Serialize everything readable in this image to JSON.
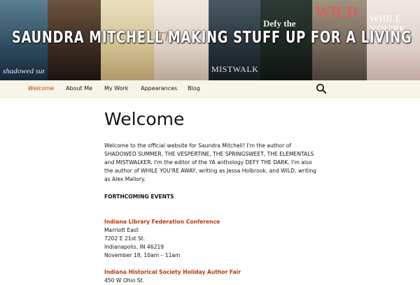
{
  "header": {
    "site_title": "SAUNDRA MITCHELL MAKING STUFF UP FOR A LIVING",
    "covers": [
      {
        "name": "shadowed-summer",
        "title": "shadowed summer",
        "bg": "linear-gradient(180deg,#5c7f92 0%,#304f62 55%,#16283a 100%)",
        "color": "#dbe9f2"
      },
      {
        "name": "the-vespertine",
        "title": "",
        "bg": "linear-gradient(180deg,#6e553f 0%,#3a2a20 60%,#1d1410 100%)",
        "color": "#e6d8c4"
      },
      {
        "name": "the-springsweet",
        "title": "",
        "bg": "linear-gradient(180deg,#ebe0c0 0%,#d2c394 55%,#b09868 100%)",
        "color": "#6b5230"
      },
      {
        "name": "the-elementals",
        "title": "The",
        "bg": "linear-gradient(180deg,#f1e9e2 0%,#dcd0c4 60%,#b9a896 100%)",
        "color": "#9c8a78"
      },
      {
        "name": "windswept",
        "title": "",
        "bg": "linear-gradient(180deg,#a8bccd 0%,#7f95a6 55%,#5a6b78 100%)",
        "color": "#eef3f7"
      },
      {
        "name": "mistwalker",
        "title": "MISTWALKER",
        "bg": "linear-gradient(180deg,#4a5a64 0%,#26313a 60%,#141a20 100%)",
        "color": "#dfe6ea"
      },
      {
        "name": "defy-the-dark",
        "title": "Defy the",
        "bg": "linear-gradient(180deg,#2f3a34 0%,#1c2520 60%,#0e1310 100%)",
        "color": "#f1f1e8"
      },
      {
        "name": "wild",
        "title": "WILD",
        "bg": "linear-gradient(180deg,#a29380 0%,#776a5c 55%,#4a4036 100%)",
        "color": "#d9615c"
      },
      {
        "name": "while-youre-away",
        "title": "WHILE YOU'RE AWAY",
        "bg": "linear-gradient(180deg,#f2e9e5 0%,#ddd0ca 60%,#c2a9a0 100%)",
        "color": "#ffffff"
      }
    ]
  },
  "nav": {
    "items": [
      {
        "label": "Welcome",
        "active": true
      },
      {
        "label": "About Me",
        "active": false
      },
      {
        "label": "My Work",
        "active": false
      },
      {
        "label": "Appearances",
        "active": false
      },
      {
        "label": "Blog",
        "active": false
      }
    ],
    "search_icon": "search-icon"
  },
  "content": {
    "title": "Welcome",
    "intro": "Welcome to the official website for Saundra Mitchell! I'm the author of SHADOWED SUMMER, THE VESPERTINE, THE SPRINGSWEET, THE ELEMENTALS and MISTWALKER. I'm the editor of the YA anthology DEFY THE DARK. I'm also the author of WHILE YOU'RE AWAY, writing as Jessa Holbrook, and WILD, writing as Alex Mallory.",
    "section_heading": "FORTHCOMING EVENTS",
    "events": [
      {
        "name": "Indiana Library Federation Conference",
        "lines": [
          "Marriott East",
          "7202 E 21st St.",
          "Indianapolis, IN 46219",
          "November 18, 10am – 11am"
        ]
      },
      {
        "name": "Indiana Historical Society Holiday Author Fair",
        "lines": [
          "450 W Ohio St."
        ]
      }
    ]
  },
  "colors": {
    "accent": "#bc360a",
    "nav_bg": "#f7f5e7",
    "text": "#141412"
  }
}
